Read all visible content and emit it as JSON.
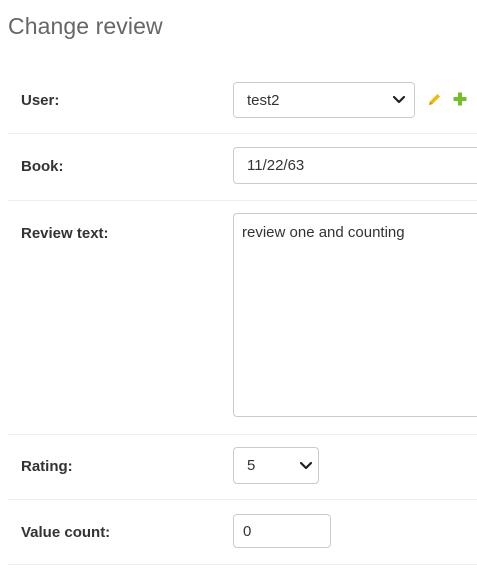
{
  "page": {
    "title": "Change review"
  },
  "form": {
    "user": {
      "label": "User:",
      "value": "test2"
    },
    "book": {
      "label": "Book:",
      "value": "11/22/63"
    },
    "review_text": {
      "label": "Review text:",
      "value": "review one and counting"
    },
    "rating": {
      "label": "Rating:",
      "value": "5"
    },
    "value_count": {
      "label": "Value count:",
      "value": "0"
    }
  },
  "icons": {
    "edit": "pencil-icon",
    "add": "plus-icon"
  },
  "colors": {
    "edit_icon": "#efb80b",
    "add_icon": "#70bf2b",
    "label_text": "#333333",
    "title_text": "#666666",
    "border": "#cccccc",
    "row_divider": "#eeeeee"
  }
}
